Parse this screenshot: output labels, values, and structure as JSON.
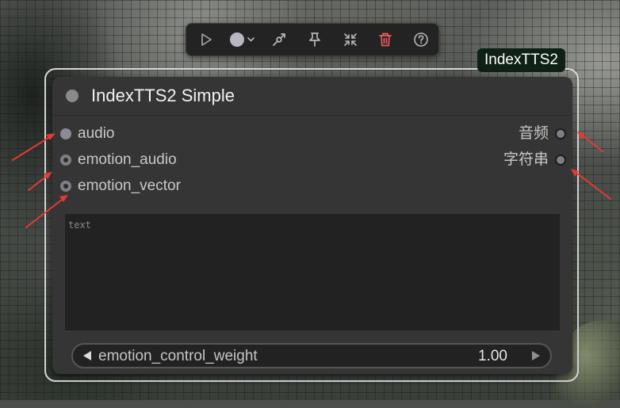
{
  "toolbar": {
    "icons": [
      "play-icon",
      "color-circle-icon",
      "chevron-down-icon",
      "bypass-icon",
      "pin-icon",
      "collapse-icon",
      "trash-icon",
      "help-icon"
    ]
  },
  "badge": {
    "label": "IndexTTS2"
  },
  "node": {
    "title": "IndexTTS2 Simple",
    "inputs": [
      {
        "label": "audio"
      },
      {
        "label": "emotion_audio"
      },
      {
        "label": "emotion_vector"
      }
    ],
    "outputs": [
      {
        "label": "音频"
      },
      {
        "label": "字符串"
      }
    ],
    "text_widget": {
      "placeholder": "text",
      "value": ""
    },
    "number_widget": {
      "label": "emotion_control_weight",
      "value": "1.00"
    }
  },
  "colors": {
    "accent_red": "#e53935",
    "trash_red": "#f05a5a",
    "badge_bg": "#0f2014",
    "node_bg": "#353535"
  }
}
